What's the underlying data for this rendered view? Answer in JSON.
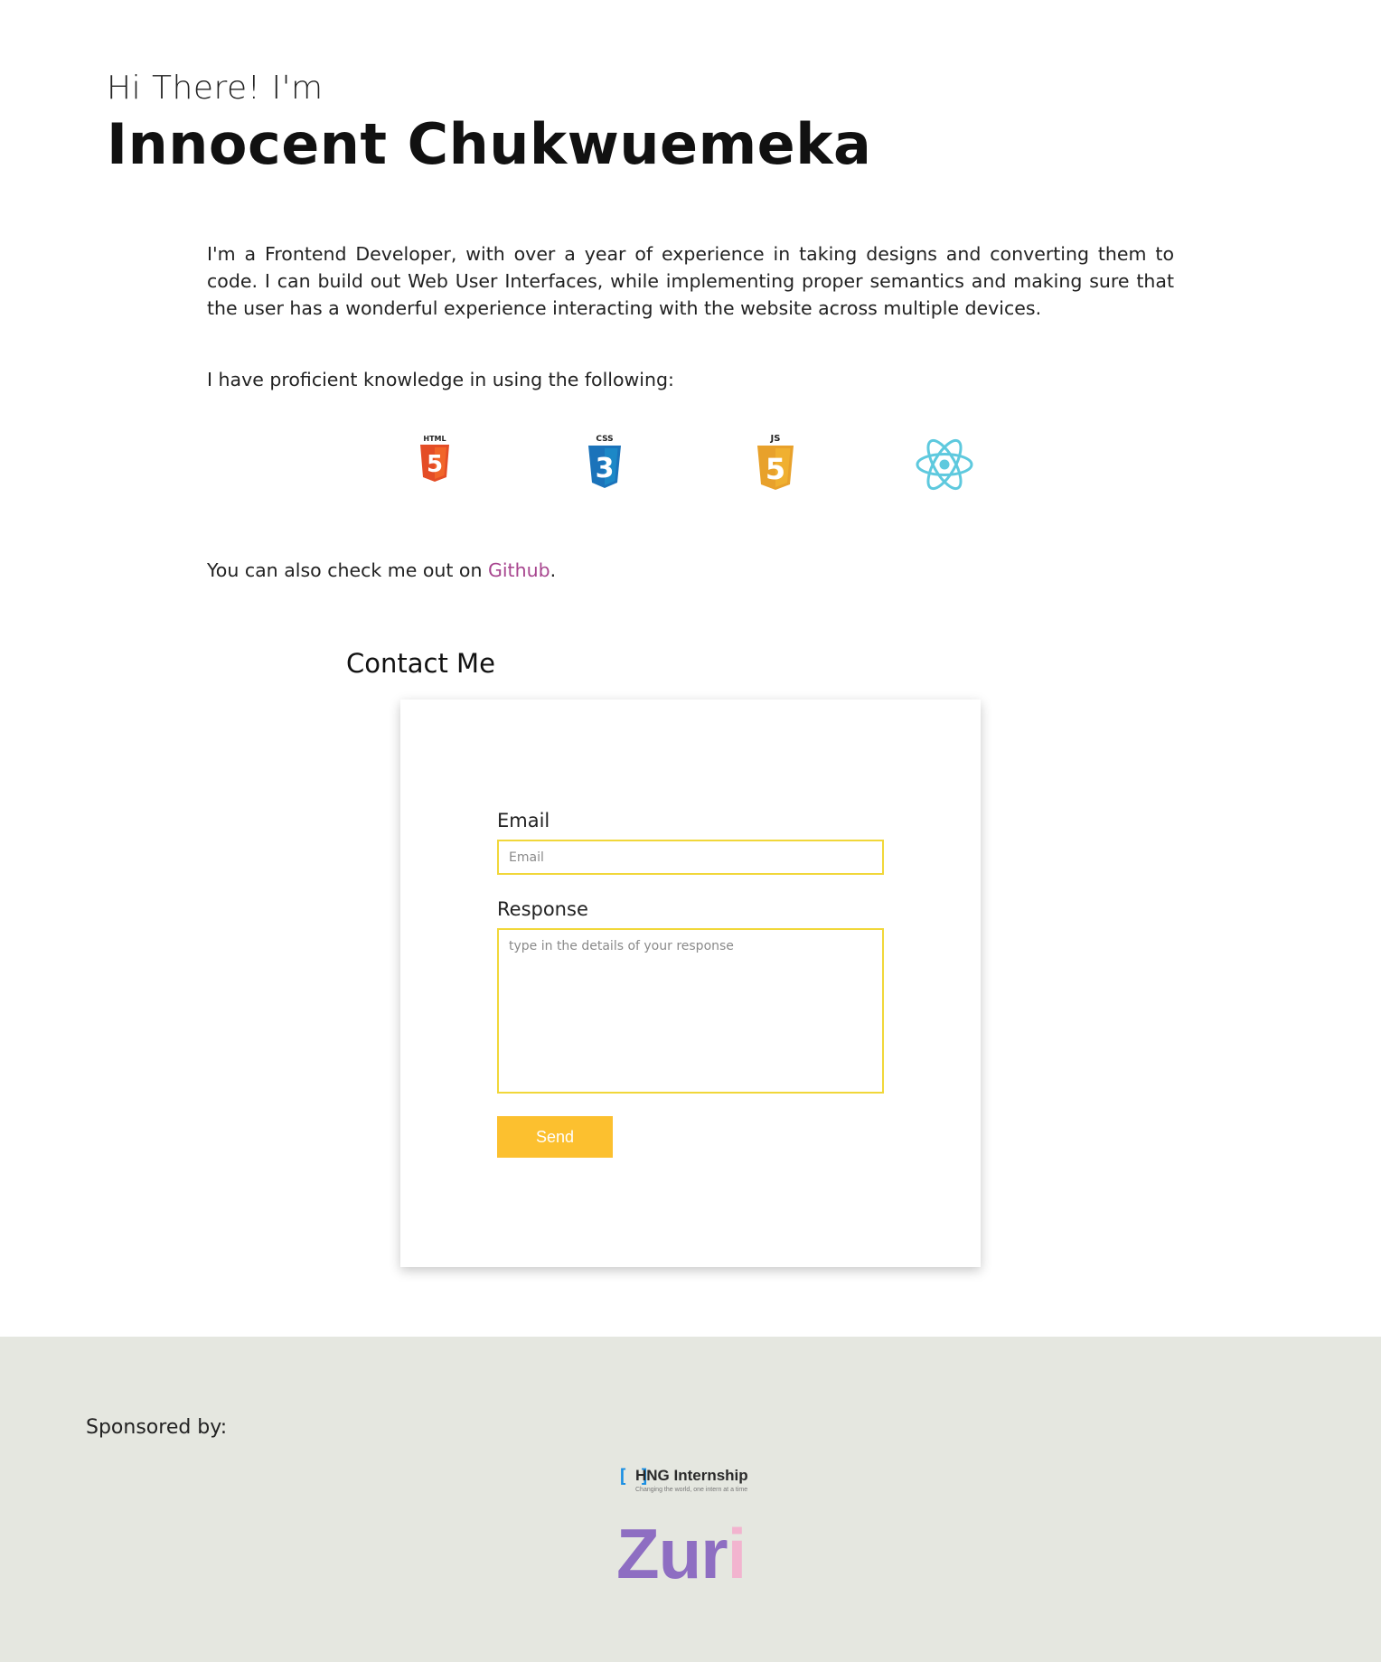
{
  "hero": {
    "greeting": "Hi There! I'm",
    "name": "Innocent Chukwuemeka"
  },
  "about": {
    "paragraph": "I'm a Frontend Developer, with over a year of experience in taking designs and converting them to code. I can build out Web User Interfaces, while implementing proper semantics and making sure that the user has a wonderful experience interacting with the website across multiple devices.",
    "skills_intro": "I have proficient knowledge in using the following:"
  },
  "tech_stack": [
    {
      "icon": "html5-icon",
      "label": "HTML",
      "glyph": "5",
      "color": "#e44d26",
      "shade": "#f16529"
    },
    {
      "icon": "css3-icon",
      "label": "CSS",
      "glyph": "3",
      "color": "#1b73ba",
      "shade": "#1c88c7"
    },
    {
      "icon": "javascript-icon",
      "label": "JS",
      "glyph": "5",
      "color": "#e8a12b",
      "shade": "#f0b030"
    },
    {
      "icon": "react-icon",
      "label": "",
      "glyph": "",
      "color": "#5ec9de",
      "shade": ""
    }
  ],
  "github": {
    "prefix": "You can also check me out on ",
    "link_label": "Github",
    "suffix": ".",
    "link_color": "#a8468f"
  },
  "contact": {
    "title": "Contact Me",
    "email_label": "Email",
    "email_placeholder": "Email",
    "response_label": "Response",
    "response_placeholder": "type in the details of your response",
    "send_label": "Send",
    "accent_color": "#fcc02f",
    "input_border_color": "#f1d73a"
  },
  "footer": {
    "sponsored_label": "Sponsored by:",
    "hng_bracket": "[ ]",
    "hng_title": "HNG Internship",
    "hng_tagline": "Changing the world, one intern at a time",
    "zuri_main": "Zur",
    "zuri_i": "i",
    "background": "#e5e7e0"
  }
}
